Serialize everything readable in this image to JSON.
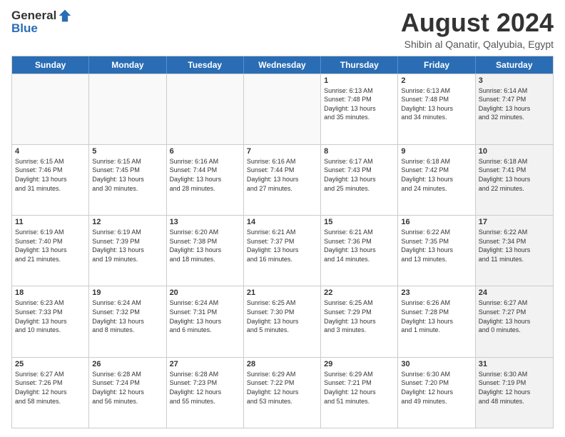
{
  "logo": {
    "general": "General",
    "blue": "Blue"
  },
  "header": {
    "month": "August 2024",
    "location": "Shibin al Qanatir, Qalyubia, Egypt"
  },
  "weekdays": [
    "Sunday",
    "Monday",
    "Tuesday",
    "Wednesday",
    "Thursday",
    "Friday",
    "Saturday"
  ],
  "rows": [
    [
      {
        "day": "",
        "info": "",
        "empty": true
      },
      {
        "day": "",
        "info": "",
        "empty": true
      },
      {
        "day": "",
        "info": "",
        "empty": true
      },
      {
        "day": "",
        "info": "",
        "empty": true
      },
      {
        "day": "1",
        "info": "Sunrise: 6:13 AM\nSunset: 7:48 PM\nDaylight: 13 hours\nand 35 minutes."
      },
      {
        "day": "2",
        "info": "Sunrise: 6:13 AM\nSunset: 7:48 PM\nDaylight: 13 hours\nand 34 minutes."
      },
      {
        "day": "3",
        "info": "Sunrise: 6:14 AM\nSunset: 7:47 PM\nDaylight: 13 hours\nand 32 minutes.",
        "shaded": true
      }
    ],
    [
      {
        "day": "4",
        "info": "Sunrise: 6:15 AM\nSunset: 7:46 PM\nDaylight: 13 hours\nand 31 minutes."
      },
      {
        "day": "5",
        "info": "Sunrise: 6:15 AM\nSunset: 7:45 PM\nDaylight: 13 hours\nand 30 minutes."
      },
      {
        "day": "6",
        "info": "Sunrise: 6:16 AM\nSunset: 7:44 PM\nDaylight: 13 hours\nand 28 minutes."
      },
      {
        "day": "7",
        "info": "Sunrise: 6:16 AM\nSunset: 7:44 PM\nDaylight: 13 hours\nand 27 minutes."
      },
      {
        "day": "8",
        "info": "Sunrise: 6:17 AM\nSunset: 7:43 PM\nDaylight: 13 hours\nand 25 minutes."
      },
      {
        "day": "9",
        "info": "Sunrise: 6:18 AM\nSunset: 7:42 PM\nDaylight: 13 hours\nand 24 minutes."
      },
      {
        "day": "10",
        "info": "Sunrise: 6:18 AM\nSunset: 7:41 PM\nDaylight: 13 hours\nand 22 minutes.",
        "shaded": true
      }
    ],
    [
      {
        "day": "11",
        "info": "Sunrise: 6:19 AM\nSunset: 7:40 PM\nDaylight: 13 hours\nand 21 minutes."
      },
      {
        "day": "12",
        "info": "Sunrise: 6:19 AM\nSunset: 7:39 PM\nDaylight: 13 hours\nand 19 minutes."
      },
      {
        "day": "13",
        "info": "Sunrise: 6:20 AM\nSunset: 7:38 PM\nDaylight: 13 hours\nand 18 minutes."
      },
      {
        "day": "14",
        "info": "Sunrise: 6:21 AM\nSunset: 7:37 PM\nDaylight: 13 hours\nand 16 minutes."
      },
      {
        "day": "15",
        "info": "Sunrise: 6:21 AM\nSunset: 7:36 PM\nDaylight: 13 hours\nand 14 minutes."
      },
      {
        "day": "16",
        "info": "Sunrise: 6:22 AM\nSunset: 7:35 PM\nDaylight: 13 hours\nand 13 minutes."
      },
      {
        "day": "17",
        "info": "Sunrise: 6:22 AM\nSunset: 7:34 PM\nDaylight: 13 hours\nand 11 minutes.",
        "shaded": true
      }
    ],
    [
      {
        "day": "18",
        "info": "Sunrise: 6:23 AM\nSunset: 7:33 PM\nDaylight: 13 hours\nand 10 minutes."
      },
      {
        "day": "19",
        "info": "Sunrise: 6:24 AM\nSunset: 7:32 PM\nDaylight: 13 hours\nand 8 minutes."
      },
      {
        "day": "20",
        "info": "Sunrise: 6:24 AM\nSunset: 7:31 PM\nDaylight: 13 hours\nand 6 minutes."
      },
      {
        "day": "21",
        "info": "Sunrise: 6:25 AM\nSunset: 7:30 PM\nDaylight: 13 hours\nand 5 minutes."
      },
      {
        "day": "22",
        "info": "Sunrise: 6:25 AM\nSunset: 7:29 PM\nDaylight: 13 hours\nand 3 minutes."
      },
      {
        "day": "23",
        "info": "Sunrise: 6:26 AM\nSunset: 7:28 PM\nDaylight: 13 hours\nand 1 minute."
      },
      {
        "day": "24",
        "info": "Sunrise: 6:27 AM\nSunset: 7:27 PM\nDaylight: 13 hours\nand 0 minutes.",
        "shaded": true
      }
    ],
    [
      {
        "day": "25",
        "info": "Sunrise: 6:27 AM\nSunset: 7:26 PM\nDaylight: 12 hours\nand 58 minutes."
      },
      {
        "day": "26",
        "info": "Sunrise: 6:28 AM\nSunset: 7:24 PM\nDaylight: 12 hours\nand 56 minutes."
      },
      {
        "day": "27",
        "info": "Sunrise: 6:28 AM\nSunset: 7:23 PM\nDaylight: 12 hours\nand 55 minutes."
      },
      {
        "day": "28",
        "info": "Sunrise: 6:29 AM\nSunset: 7:22 PM\nDaylight: 12 hours\nand 53 minutes."
      },
      {
        "day": "29",
        "info": "Sunrise: 6:29 AM\nSunset: 7:21 PM\nDaylight: 12 hours\nand 51 minutes."
      },
      {
        "day": "30",
        "info": "Sunrise: 6:30 AM\nSunset: 7:20 PM\nDaylight: 12 hours\nand 49 minutes."
      },
      {
        "day": "31",
        "info": "Sunrise: 6:30 AM\nSunset: 7:19 PM\nDaylight: 12 hours\nand 48 minutes.",
        "shaded": true
      }
    ]
  ]
}
